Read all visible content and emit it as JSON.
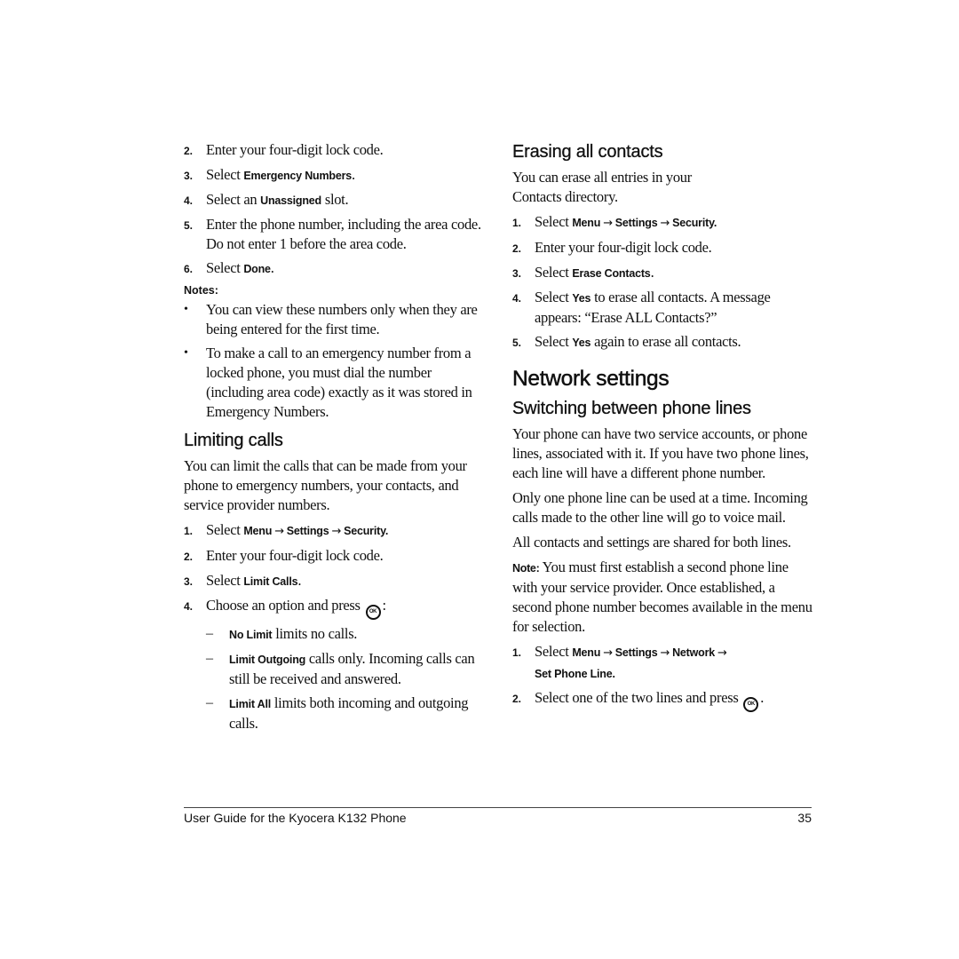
{
  "left_column": {
    "steps_top": [
      {
        "num": "2.",
        "text": "Enter your four-digit lock code."
      },
      {
        "num": "3.",
        "pre": "Select ",
        "bold": "Emergency Numbers",
        "post": "."
      },
      {
        "num": "4.",
        "pre": "Select an ",
        "bold": "Unassigned",
        "post": " slot."
      },
      {
        "num": "5.",
        "text": "Enter the phone number, including the area code. Do not enter 1 before the area code."
      },
      {
        "num": "6.",
        "pre": "Select ",
        "bold": "Done",
        "post": "."
      }
    ],
    "notes_label": "Notes:",
    "notes": [
      "You can view these numbers only when they are being entered for the first time.",
      "To make a call to an emergency number from a locked phone, you must dial the number (including area code) exactly as it was stored in Emergency Numbers."
    ],
    "limiting_calls": {
      "heading": "Limiting calls",
      "intro": "You can limit the calls that can be made from your phone to emergency numbers, your contacts, and service provider numbers.",
      "step1": {
        "num": "1.",
        "pre": "Select ",
        "menu": "Menu",
        "settings": "Settings",
        "security": "Security",
        "post": "."
      },
      "step2": {
        "num": "2.",
        "text": "Enter your four-digit lock code."
      },
      "step3": {
        "num": "3.",
        "pre": "Select ",
        "bold": "Limit Calls",
        "post": "."
      },
      "step4": {
        "num": "4.",
        "text": "Choose an option and press ",
        "post": ":"
      },
      "options": [
        {
          "bold": "No Limit",
          "text": " limits no calls."
        },
        {
          "bold": "Limit Outgoing",
          "text": " calls only. Incoming calls can still be received and answered."
        },
        {
          "bold": "Limit All",
          "text": " limits both incoming and outgoing calls."
        }
      ]
    }
  },
  "right_column": {
    "erasing": {
      "heading": "Erasing all contacts",
      "intro": "You can erase all entries in your Contacts directory.",
      "step1": {
        "num": "1.",
        "pre": "Select ",
        "menu": "Menu",
        "settings": "Settings",
        "security": "Security",
        "post": "."
      },
      "step2": {
        "num": "2.",
        "text": "Enter your four-digit lock code."
      },
      "step3": {
        "num": "3.",
        "pre": "Select ",
        "bold": "Erase Contacts",
        "post": "."
      },
      "step4": {
        "num": "4.",
        "pre": "Select ",
        "bold": "Yes",
        "post": " to erase all contacts. A message appears: “Erase ALL Contacts?”"
      },
      "step5": {
        "num": "5.",
        "pre": "Select ",
        "bold": "Yes",
        "post": " again to erase all contacts."
      }
    },
    "network": {
      "heading": "Network settings",
      "subheading": "Switching between phone lines",
      "para1": "Your phone can have two service accounts, or phone lines, associated with it. If you have two phone lines, each line will have a different phone number.",
      "para2": "Only one phone line can be used at a time. Incoming calls made to the other line will go to voice mail.",
      "para3": "All contacts and settings are shared for both lines.",
      "note_label": "Note:",
      "note_text": " You must first establish a second phone line with your service provider. Once established, a second phone number becomes available in the menu for selection.",
      "step1": {
        "num": "1.",
        "pre": "Select ",
        "menu": "Menu",
        "settings": "Settings",
        "network": "Network",
        "setline": "Set Phone Line",
        "post": "."
      },
      "step2": {
        "num": "2.",
        "text": "Select one of the two lines and press ",
        "post": "."
      }
    }
  },
  "icons": {
    "arrow": "→",
    "ok": "OK",
    "bullet": "•",
    "dash": "–"
  },
  "footer": {
    "title": "User Guide for the Kyocera K132 Phone",
    "page_number": "35"
  }
}
